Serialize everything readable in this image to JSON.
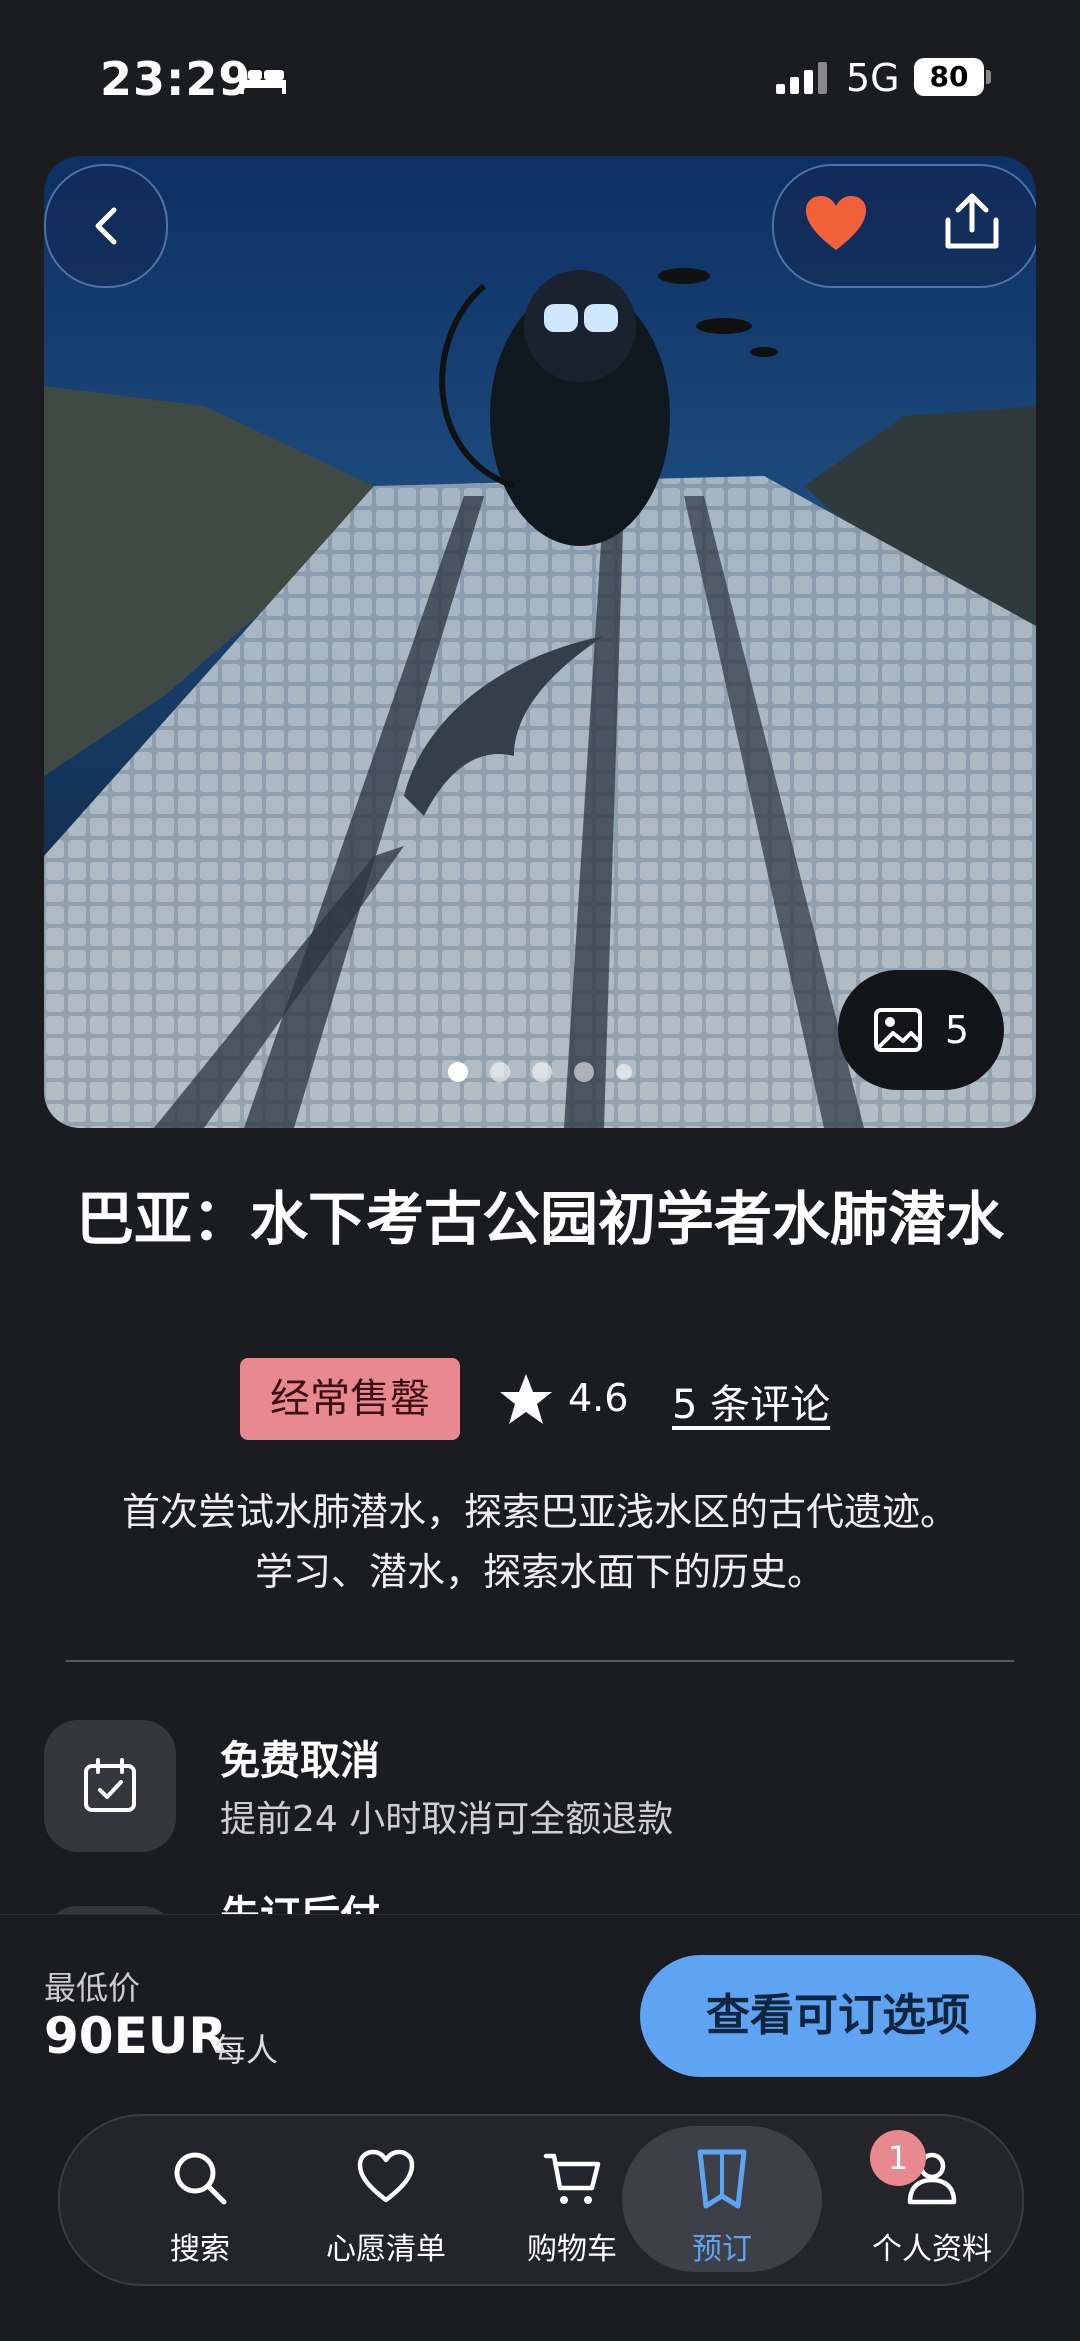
{
  "status_bar": {
    "time": "23:29",
    "network": "5G",
    "battery": "80"
  },
  "hero": {
    "photo_count": "5",
    "dots_total": 5,
    "dots_active_index": 0
  },
  "title": "巴亚：水下考古公园初学者水肺潜水",
  "badge": "经常售罄",
  "rating": "4.6",
  "reviews_link": "5 条评论",
  "description_line1": "首次尝试水肺潜水，探索巴亚浅水区的古代遗迹。",
  "description_line2": "学习、潜水，探索水面下的历史。",
  "features": [
    {
      "title": "免费取消",
      "subtitle": "提前24 小时取消可全额退款",
      "icon": "calendar-check-icon"
    },
    {
      "title": "先订后付",
      "icon": "wallet-icon"
    }
  ],
  "booking": {
    "price_label": "最低价",
    "price": "90EUR",
    "per": "每人",
    "cta": "查看可订选项"
  },
  "tabs": [
    {
      "label": "搜索",
      "icon": "search-icon"
    },
    {
      "label": "心愿清单",
      "icon": "heart-outline-icon"
    },
    {
      "label": "购物车",
      "icon": "cart-icon"
    },
    {
      "label": "预订",
      "icon": "bookings-icon",
      "active": true
    },
    {
      "label": "个人资料",
      "icon": "profile-icon"
    }
  ],
  "notification_count": "1",
  "colors": {
    "accent": "#5ea4f2",
    "badge": "#e8898f",
    "heart": "#f0613a",
    "background": "#1b1c20"
  }
}
